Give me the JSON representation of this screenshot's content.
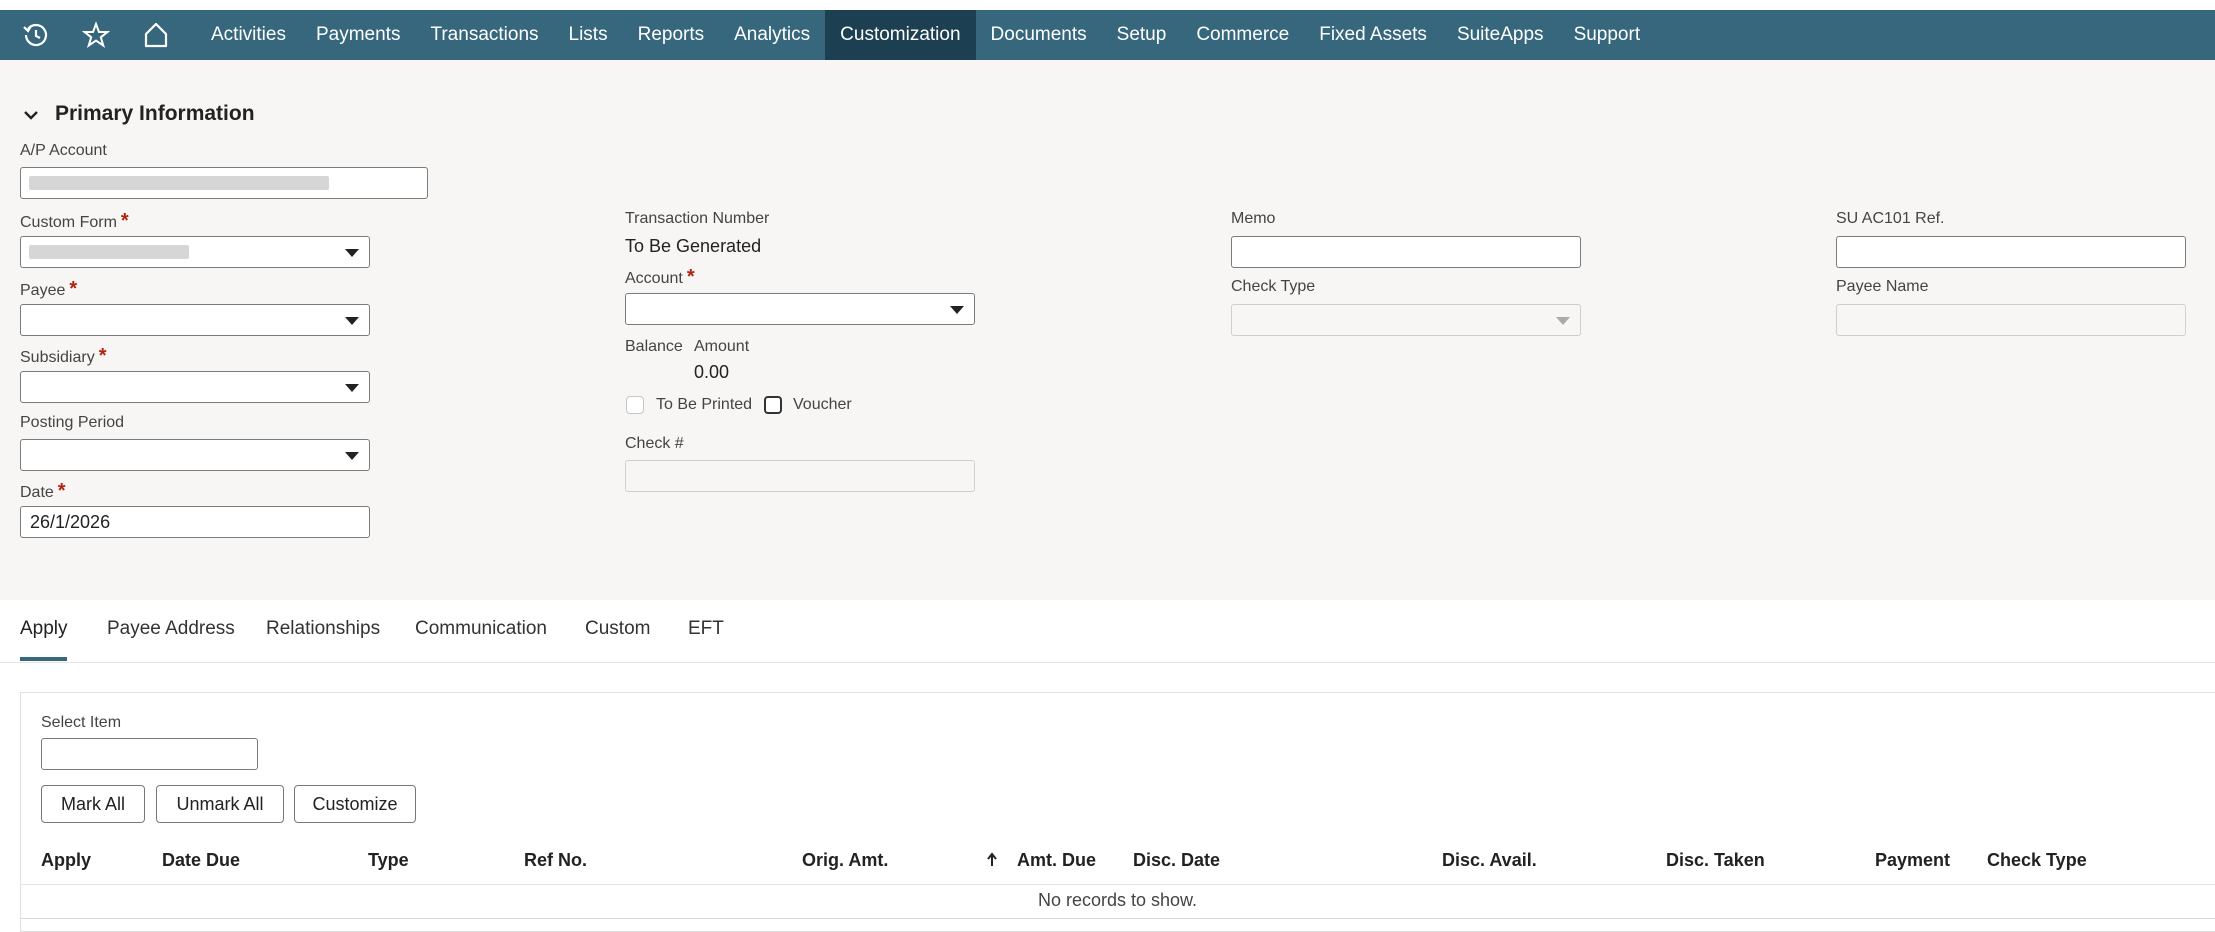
{
  "nav": {
    "icons": [
      "history-icon",
      "star-icon",
      "home-icon"
    ],
    "items": [
      "Activities",
      "Payments",
      "Transactions",
      "Lists",
      "Reports",
      "Analytics",
      "Customization",
      "Documents",
      "Setup",
      "Commerce",
      "Fixed Assets",
      "SuiteApps",
      "Support"
    ],
    "active": "Customization",
    "bg_color": "#36677d",
    "active_color": "#1c3f52"
  },
  "primary": {
    "title": "Primary Information",
    "ap_account": {
      "label": "A/P Account"
    },
    "custom_form": {
      "label": "Custom Form",
      "required": "*"
    },
    "payee": {
      "label": "Payee",
      "required": "*"
    },
    "subsidiary": {
      "label": "Subsidiary",
      "required": "*"
    },
    "posting_period": {
      "label": "Posting Period"
    },
    "date": {
      "label": "Date",
      "required": "*",
      "value": "26/1/2026"
    },
    "transaction_number": {
      "label": "Transaction Number",
      "value": "To Be Generated"
    },
    "account": {
      "label": "Account",
      "required": "*"
    },
    "balance": {
      "label": "Balance"
    },
    "amount": {
      "label": "Amount",
      "value": "0.00"
    },
    "to_be_printed": {
      "label": "To Be Printed"
    },
    "voucher": {
      "label": "Voucher"
    },
    "check_no": {
      "label": "Check #"
    },
    "memo": {
      "label": "Memo"
    },
    "check_type": {
      "label": "Check Type"
    },
    "su_ref": {
      "label": "SU AC101 Ref."
    },
    "payee_name": {
      "label": "Payee Name"
    }
  },
  "tabs": [
    "Apply",
    "Payee Address",
    "Relationships",
    "Communication",
    "Custom",
    "EFT"
  ],
  "apply": {
    "select_item_label": "Select Item",
    "buttons": {
      "mark_all": "Mark All",
      "unmark_all": "Unmark All",
      "customize": "Customize"
    },
    "columns": [
      "Apply",
      "Date Due",
      "Type",
      "Ref No.",
      "Orig. Amt.",
      "Amt. Due",
      "Disc. Date",
      "Disc. Avail.",
      "Disc. Taken",
      "Payment",
      "Check Type"
    ],
    "sort_icon": "arrow-up-icon",
    "empty_message": "No records to show."
  }
}
